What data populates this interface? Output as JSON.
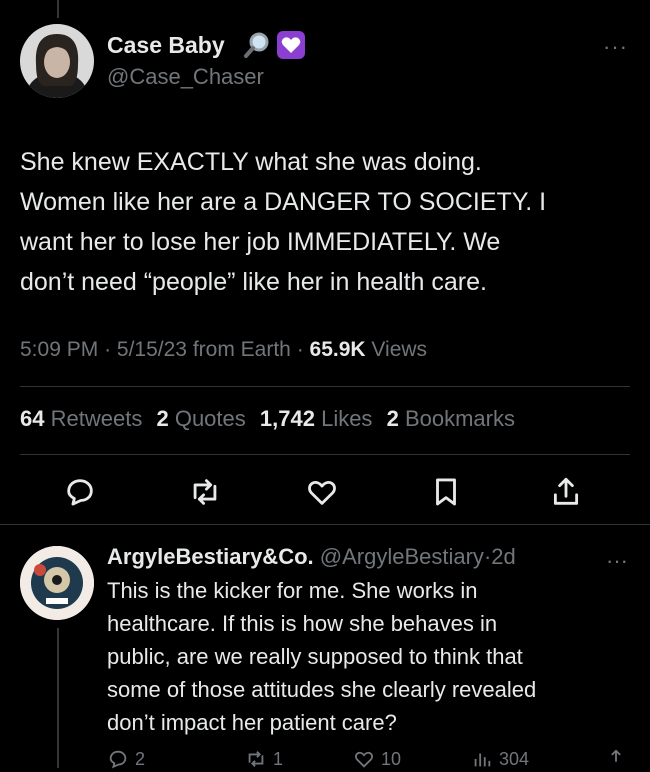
{
  "tweet": {
    "author_name": "Case Baby",
    "author_handle": "@Case_Chaser",
    "more_glyph": "···",
    "text_lines": [
      "She knew EXACTLY what she was doing.",
      "Women like her are a DANGER TO SOCIETY. I",
      "want her to lose her job IMMEDIATELY. We",
      "don’t need “people” like her in health care."
    ],
    "time": "5:09 PM",
    "date": "5/15/23",
    "source": "from Earth",
    "views_count": "65.9K",
    "views_label": "Views",
    "stats": {
      "retweets_count": "64",
      "retweets_label": "Retweets",
      "quotes_count": "2",
      "quotes_label": "Quotes",
      "likes_count": "1,742",
      "likes_label": "Likes",
      "bookmarks_count": "2",
      "bookmarks_label": "Bookmarks"
    },
    "badge_icons": [
      "magnifying-glass-icon",
      "purple-heart-icon"
    ]
  },
  "reply": {
    "author_name": "ArgyleBestiary&Co.",
    "author_handle": "@ArgyleBestiary",
    "age": "2d",
    "more_glyph": "···",
    "text_lines": [
      "This is the kicker for me. She works in",
      "healthcare. If this is how she behaves in",
      "public, are we really supposed to think that",
      "some of those attitudes she clearly revealed",
      "don’t impact her patient care?"
    ],
    "replies": "2",
    "retweets": "1",
    "likes": "10",
    "views": "304"
  },
  "colors": {
    "background": "#000000",
    "text": "#e7e9ea",
    "muted": "#71767b",
    "divider": "#2f3336",
    "badge_purple": "#8b3fd1"
  }
}
